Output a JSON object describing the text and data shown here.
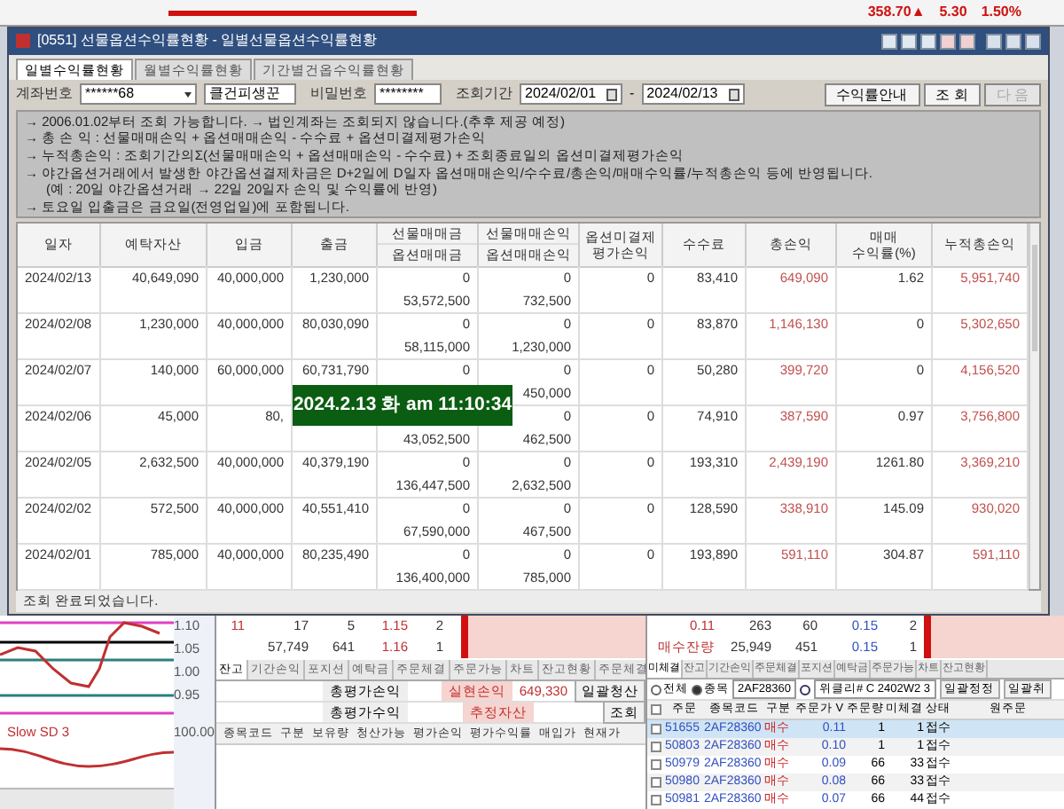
{
  "top_strip": {
    "quote": [
      {
        "text": "358.70▲",
        "color": "#d01010"
      },
      {
        "text": "5.30",
        "color": "#d01010"
      },
      {
        "text": "1.50%",
        "color": "#d01010"
      }
    ]
  },
  "dialog": {
    "title": "[0551] 선물옵션수익률현황 - 일별선물옵션수익률현황",
    "tabs": [
      {
        "label": "일별수익률현황",
        "selected": true
      },
      {
        "label": "월별수익률현황",
        "selected": false
      },
      {
        "label": "기간별건옵수익률현황",
        "selected": false
      }
    ],
    "filters": {
      "account_label": "계좌번호",
      "account": "******68",
      "account_name": "클건피생꾼",
      "password_label": "비밀번호",
      "password": "********",
      "period_label": "조회기간",
      "from": "2024/02/01",
      "separator": "-",
      "to": "2024/02/13"
    },
    "buttons": [
      {
        "label": "수익률안내",
        "disabled": false
      },
      {
        "label": "조 회",
        "disabled": false
      },
      {
        "label": "다 음",
        "disabled": true
      }
    ],
    "notes": [
      "→ 2006.01.02부터 조회 가능합니다. → 법인계좌는 조회되지 않습니다.(추후 제공 예정)",
      "→ 총 손 익 : 선물매매손익 + 옵션매매손익 - 수수료 + 옵션미결제평가손익",
      "→ 누적총손익 : 조회기간의Σ(선물매매손익 + 옵션매매손익 - 수수료) + 조회종료일의 옵션미결제평가손익",
      "→ 야간옵션거래에서 발생한 야간옵션결제차금은 D+2일에 D일자 옵션매매손익/수수료/총손익/매매수익률/누적총손익 등에 반영됩니다.",
      "(예 : 20일 야간옵션거래 → 22일 20일자 손익 및 수익률에 반영)",
      "→ 토요일 입출금은 금요일(전영업일)에 포함됩니다."
    ],
    "table": {
      "columns": [
        {
          "kind": "single",
          "label": "일자"
        },
        {
          "kind": "single",
          "label": "예탁자산"
        },
        {
          "kind": "single",
          "label": "입금"
        },
        {
          "kind": "single",
          "label": "출금"
        },
        {
          "kind": "stacked",
          "top": "선물매매금",
          "bottom": "옵션매매금"
        },
        {
          "kind": "stacked",
          "top": "선물매매손익",
          "bottom": "옵션매매손익"
        },
        {
          "kind": "wrapped",
          "lines": [
            "옵션미결제",
            "평가손익"
          ]
        },
        {
          "kind": "single",
          "label": "수수료"
        },
        {
          "kind": "single",
          "label": "총손익",
          "color": "#c0504d"
        },
        {
          "kind": "wrapped",
          "lines": [
            "매매",
            "수익률(%)"
          ]
        },
        {
          "kind": "single",
          "label": "누적총손익",
          "color": "#c0504d"
        }
      ],
      "rows": [
        [
          "2024/02/13",
          "40,649,090",
          "40,000,000",
          "1,230,000",
          [
            "0",
            "53,572,500"
          ],
          [
            "0",
            "732,500"
          ],
          "0",
          "83,410",
          "649,090",
          "1.62",
          "5,951,740"
        ],
        [
          "2024/02/08",
          "1,230,000",
          "40,000,000",
          "80,030,090",
          [
            "0",
            "58,115,000"
          ],
          [
            "0",
            "1,230,000"
          ],
          "0",
          "83,870",
          "1,146,130",
          "0",
          "5,302,650"
        ],
        [
          "2024/02/07",
          "140,000",
          "60,000,000",
          "60,731,790",
          [
            "0",
            null
          ],
          [
            "0",
            "450,000"
          ],
          "0",
          "50,280",
          "399,720",
          "0",
          "4,156,520"
        ],
        [
          "2024/02/06",
          "45,000",
          "80,",
          null,
          [
            null,
            "43,052,500"
          ],
          [
            "0",
            "462,500"
          ],
          "0",
          "74,910",
          "387,590",
          "0.97",
          "3,756,800"
        ],
        [
          "2024/02/05",
          "2,632,500",
          "40,000,000",
          "40,379,190",
          [
            "0",
            "136,447,500"
          ],
          [
            "0",
            "2,632,500"
          ],
          "0",
          "193,310",
          "2,439,190",
          "1261.80",
          "3,369,210"
        ],
        [
          "2024/02/02",
          "572,500",
          "40,000,000",
          "40,551,410",
          [
            "0",
            "67,590,000"
          ],
          [
            "0",
            "467,500"
          ],
          "0",
          "128,590",
          "338,910",
          "145.09",
          "930,020"
        ],
        [
          "2024/02/01",
          "785,000",
          "40,000,000",
          "80,235,490",
          [
            "0",
            "136,400,000"
          ],
          [
            "0",
            "785,000"
          ],
          "0",
          "193,890",
          "591,110",
          "304.87",
          "591,110"
        ]
      ]
    },
    "time_overlay": "2024.2.13 화 am 11:10:34",
    "status": "조회 완료되었습니다."
  },
  "chart_panel": {
    "axis_labels": [
      "1.10",
      "1.05",
      "1.00",
      "0.95"
    ],
    "indicator": "Slow SD 3",
    "lower_label": "100.00"
  },
  "orderbook_left": {
    "rows": [
      [
        "11",
        "17",
        "5",
        "1.15",
        "2"
      ],
      [
        null,
        "57,749",
        "641",
        "1.16",
        "1"
      ]
    ]
  },
  "orderbook_right": {
    "rows": [
      [
        "0.11",
        "263",
        "60",
        "0.15",
        "2"
      ],
      [
        "매수잔량",
        "25,949",
        "451",
        "0.15",
        "1"
      ]
    ]
  },
  "balance_panel": {
    "tabs": [
      {
        "label": "잔고",
        "selected": true
      },
      {
        "label": "기간손익",
        "selected": false
      },
      {
        "label": "포지션",
        "selected": false
      },
      {
        "label": "예탁금",
        "selected": false
      },
      {
        "label": "주문체결",
        "selected": false
      },
      {
        "label": "주문가능",
        "selected": false
      },
      {
        "label": "차트",
        "selected": false
      },
      {
        "label": "잔고현황",
        "selected": false
      },
      {
        "label": "주문체결",
        "selected": false
      }
    ],
    "fields": [
      [
        {
          "label": "총평가손익"
        },
        {
          "label": "실현손익",
          "value": "649,330"
        }
      ],
      [
        {
          "label": "총평가수익"
        },
        {
          "label": "추정자산"
        }
      ]
    ],
    "buttons": [
      "일괄청산",
      "조회"
    ],
    "columns": [
      "종목코드",
      "구분",
      "보유량",
      "청산가능",
      "평가손익",
      "평가수익률",
      "매입가",
      "현재가"
    ]
  },
  "orders_panel": {
    "tabs": [
      {
        "label": "미체결",
        "selected": true
      },
      {
        "label": "잔고",
        "selected": false
      },
      {
        "label": "기간손익",
        "selected": false
      },
      {
        "label": "주문체결",
        "selected": false
      },
      {
        "label": "포지션",
        "selected": false
      },
      {
        "label": "예탁금",
        "selected": false
      },
      {
        "label": "주문가능",
        "selected": false
      },
      {
        "label": "차트",
        "selected": false
      },
      {
        "label": "잔고현황",
        "selected": false
      }
    ],
    "scope": [
      {
        "label": "전체",
        "selected": false
      },
      {
        "label": "종목",
        "selected": true
      }
    ],
    "code": "2AF28360",
    "instrument": "위클리# C 2402W2 3",
    "buttons": [
      "일괄정정",
      "일괄취"
    ],
    "header_checked": false,
    "columns": [
      "주문",
      "종목코드",
      "구분",
      "주문가 V",
      "주문량",
      "미체결",
      "상태",
      "원주문"
    ],
    "rows": [
      {
        "order": "51655",
        "code": "2AF28360",
        "side": "매수",
        "price": "0.11",
        "qty": "1",
        "open": "1",
        "status": "접수",
        "selected": true,
        "checked": false
      },
      {
        "order": "50803",
        "code": "2AF28360",
        "side": "매수",
        "price": "0.10",
        "qty": "1",
        "open": "1",
        "status": "접수",
        "selected": false,
        "checked": false
      },
      {
        "order": "50979",
        "code": "2AF28360",
        "side": "매수",
        "price": "0.09",
        "qty": "66",
        "open": "33",
        "status": "접수",
        "selected": false,
        "checked": false
      },
      {
        "order": "50980",
        "code": "2AF28360",
        "side": "매수",
        "price": "0.08",
        "qty": "66",
        "open": "33",
        "status": "접수",
        "selected": false,
        "checked": false
      },
      {
        "order": "50981",
        "code": "2AF28360",
        "side": "매수",
        "price": "0.07",
        "qty": "66",
        "open": "44",
        "status": "접수",
        "selected": false,
        "checked": false
      }
    ]
  }
}
